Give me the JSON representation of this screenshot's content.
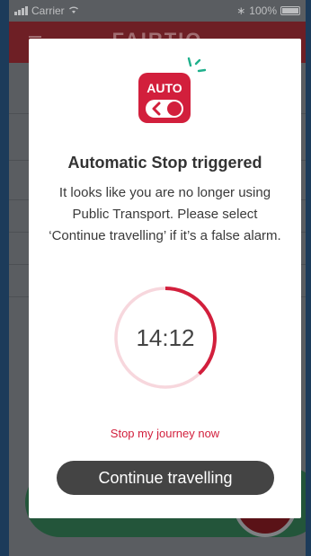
{
  "status_bar": {
    "carrier": "Carrier",
    "battery": "100%"
  },
  "app": {
    "logo": "FAIRTIQ"
  },
  "modal": {
    "icon_label": "AUTO",
    "title": "Automatic Stop triggered",
    "message": "It looks like you are no longer using Public Transport. Please select ‘Continue travelling’ if it’s a false alarm.",
    "timer": "14:12",
    "timer_progress": 0.38,
    "stop_link": "Stop my journey now",
    "continue_button": "Continue travelling"
  },
  "colors": {
    "accent": "#d21f3c",
    "teal": "#1fb08c",
    "button_dark": "#444444"
  }
}
